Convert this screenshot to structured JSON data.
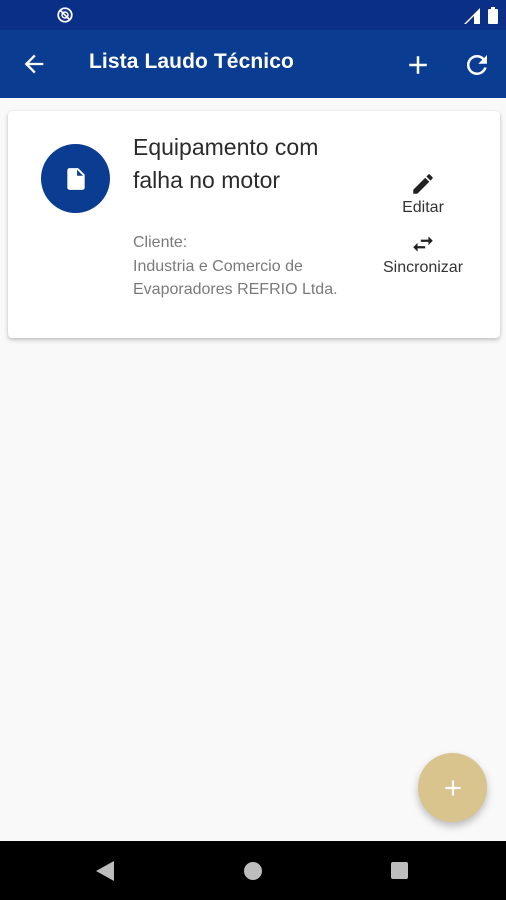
{
  "colors": {
    "status_bar": "#0a2f86",
    "app_bar": "#0a3d91",
    "accent_circle": "#0a3d91",
    "fab": "#d8c48c",
    "background": "#f9f9f9"
  },
  "status_bar": {
    "left_icon": "no-sim-icon",
    "right_icons": [
      "signal-icon",
      "battery-icon"
    ]
  },
  "app_bar": {
    "title": "Lista Laudo Técnico",
    "icons": [
      "back-arrow-icon",
      "add-icon",
      "refresh-icon"
    ]
  },
  "list": {
    "items": [
      {
        "icon": "document-icon",
        "title": "Equipamento com falha no motor",
        "client": "Cliente:\nIndustria e Comercio de Evaporadores REFRIO Ltda.",
        "actions": [
          {
            "icon": "pencil-icon",
            "label": "Editar"
          },
          {
            "icon": "sync-arrows-icon",
            "label": "Sincronizar"
          }
        ]
      }
    ]
  },
  "fab": {
    "icon": "plus-icon"
  },
  "nav_bar": {
    "icons": [
      "nav-back-icon",
      "nav-home-icon",
      "nav-recent-icon"
    ]
  }
}
